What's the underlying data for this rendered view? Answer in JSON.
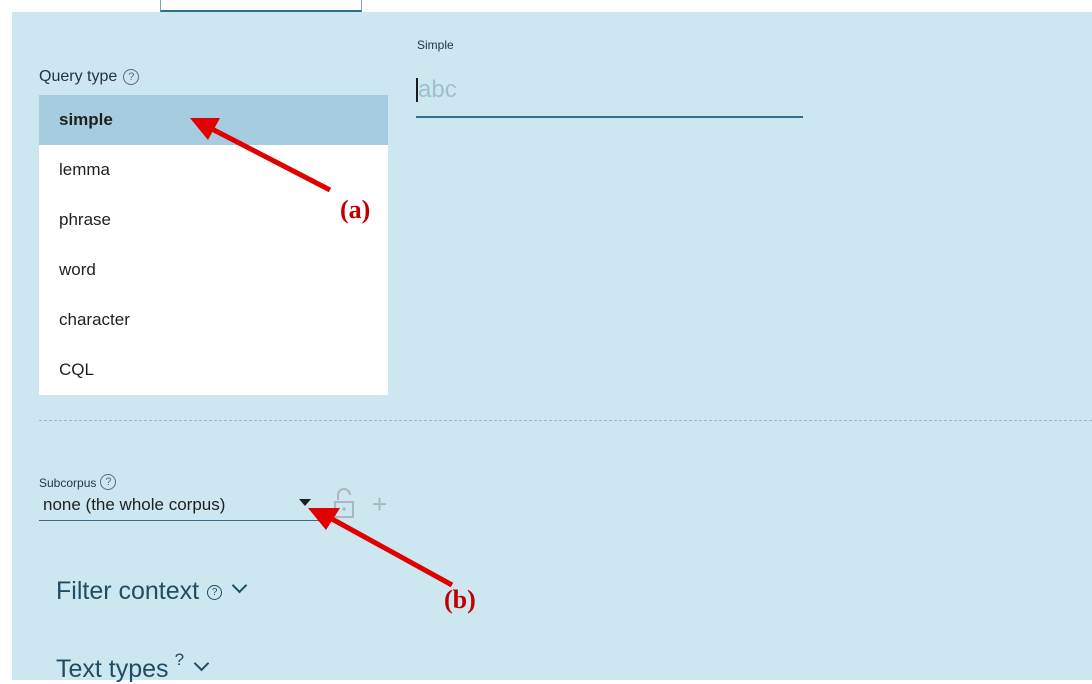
{
  "query_type": {
    "label": "Query type",
    "help_icon": "?",
    "options": [
      "simple",
      "lemma",
      "phrase",
      "word",
      "character",
      "CQL"
    ],
    "selected": "simple"
  },
  "simple_field": {
    "label": "Simple",
    "placeholder": "abc"
  },
  "subcorpus": {
    "label": "Subcorpus",
    "help_icon": "?",
    "value": "none (the whole corpus)",
    "lock_icon": "unlock-icon",
    "add_icon": "+"
  },
  "sections": {
    "filter_context": "Filter context",
    "filter_help": "?",
    "text_types": "Text types",
    "text_types_sup": "?"
  },
  "annotations": {
    "a": "(a)",
    "b": "(b)",
    "arrow_color": "#e00000"
  }
}
